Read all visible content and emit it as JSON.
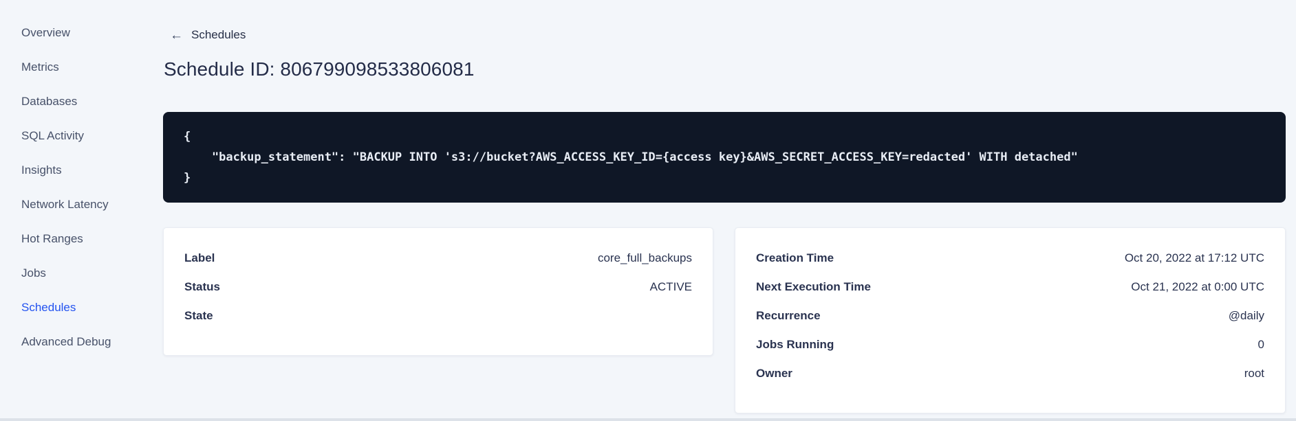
{
  "colors": {
    "background": "#f3f6fa",
    "card_background": "#ffffff",
    "code_background": "#0f1726",
    "code_text": "#e8edf5",
    "text_primary": "#2a3350",
    "accent_blue": "#2353f0"
  },
  "sidebar": {
    "items": [
      {
        "label": "Overview"
      },
      {
        "label": "Metrics"
      },
      {
        "label": "Databases"
      },
      {
        "label": "SQL Activity"
      },
      {
        "label": "Insights"
      },
      {
        "label": "Network Latency"
      },
      {
        "label": "Hot Ranges"
      },
      {
        "label": "Jobs"
      },
      {
        "label": "Schedules",
        "active": true
      },
      {
        "label": "Advanced Debug"
      }
    ]
  },
  "header": {
    "back_icon": "←",
    "back_label": "Schedules",
    "title": "Schedule ID: 806799098533806081"
  },
  "code": {
    "lines": [
      "{",
      "    \"backup_statement\": \"BACKUP INTO 's3://bucket?AWS_ACCESS_KEY_ID={access key}&AWS_SECRET_ACCESS_KEY=redacted' WITH detached\"",
      "}"
    ]
  },
  "details_card": {
    "rows": [
      {
        "label": "Label",
        "value": "core_full_backups"
      },
      {
        "label": "Status",
        "value": "ACTIVE"
      },
      {
        "label": "State",
        "value": ""
      }
    ]
  },
  "schedule_card": {
    "rows": [
      {
        "label": "Creation Time",
        "value": "Oct 20, 2022 at 17:12 UTC"
      },
      {
        "label": "Next Execution Time",
        "value": "Oct 21, 2022 at 0:00 UTC"
      },
      {
        "label": "Recurrence",
        "value": "@daily"
      },
      {
        "label": "Jobs Running",
        "value": "0"
      },
      {
        "label": "Owner",
        "value": "root"
      }
    ]
  }
}
